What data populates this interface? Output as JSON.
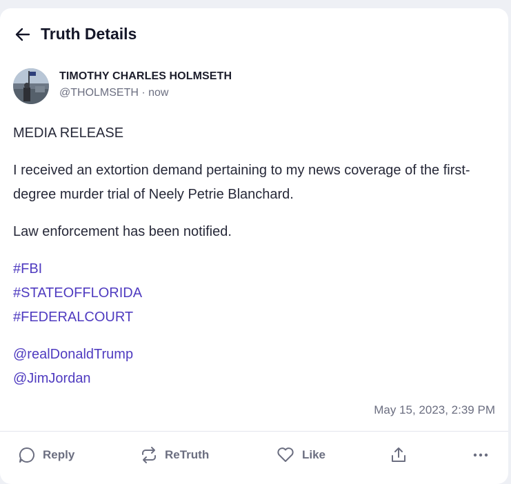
{
  "header": {
    "title": "Truth Details"
  },
  "post": {
    "author_name": "TIMOTHY CHARLES HOLMSETH",
    "author_handle": "@THOLMSETH · now",
    "paragraphs": [
      "MEDIA RELEASE",
      "I received an extortion demand pertaining to my news coverage of the first-degree murder trial of Neely Petrie Blanchard.",
      "Law enforcement has been notified."
    ],
    "hashtags": [
      "#FBI",
      "#STATEOFFLORIDA",
      "#FEDERALCOURT"
    ],
    "mentions": [
      "@realDonaldTrump",
      "@JimJordan"
    ],
    "timestamp": "May 15, 2023, 2:39 PM"
  },
  "actions": {
    "reply_label": "Reply",
    "retruth_label": "ReTruth",
    "like_label": "Like"
  },
  "colors": {
    "link": "#4f3bc0",
    "muted": "#6b6e80",
    "text": "#1c1d2b"
  },
  "icons": [
    "back-arrow-icon",
    "reply-icon",
    "retruth-icon",
    "like-icon",
    "share-icon",
    "more-icon"
  ]
}
